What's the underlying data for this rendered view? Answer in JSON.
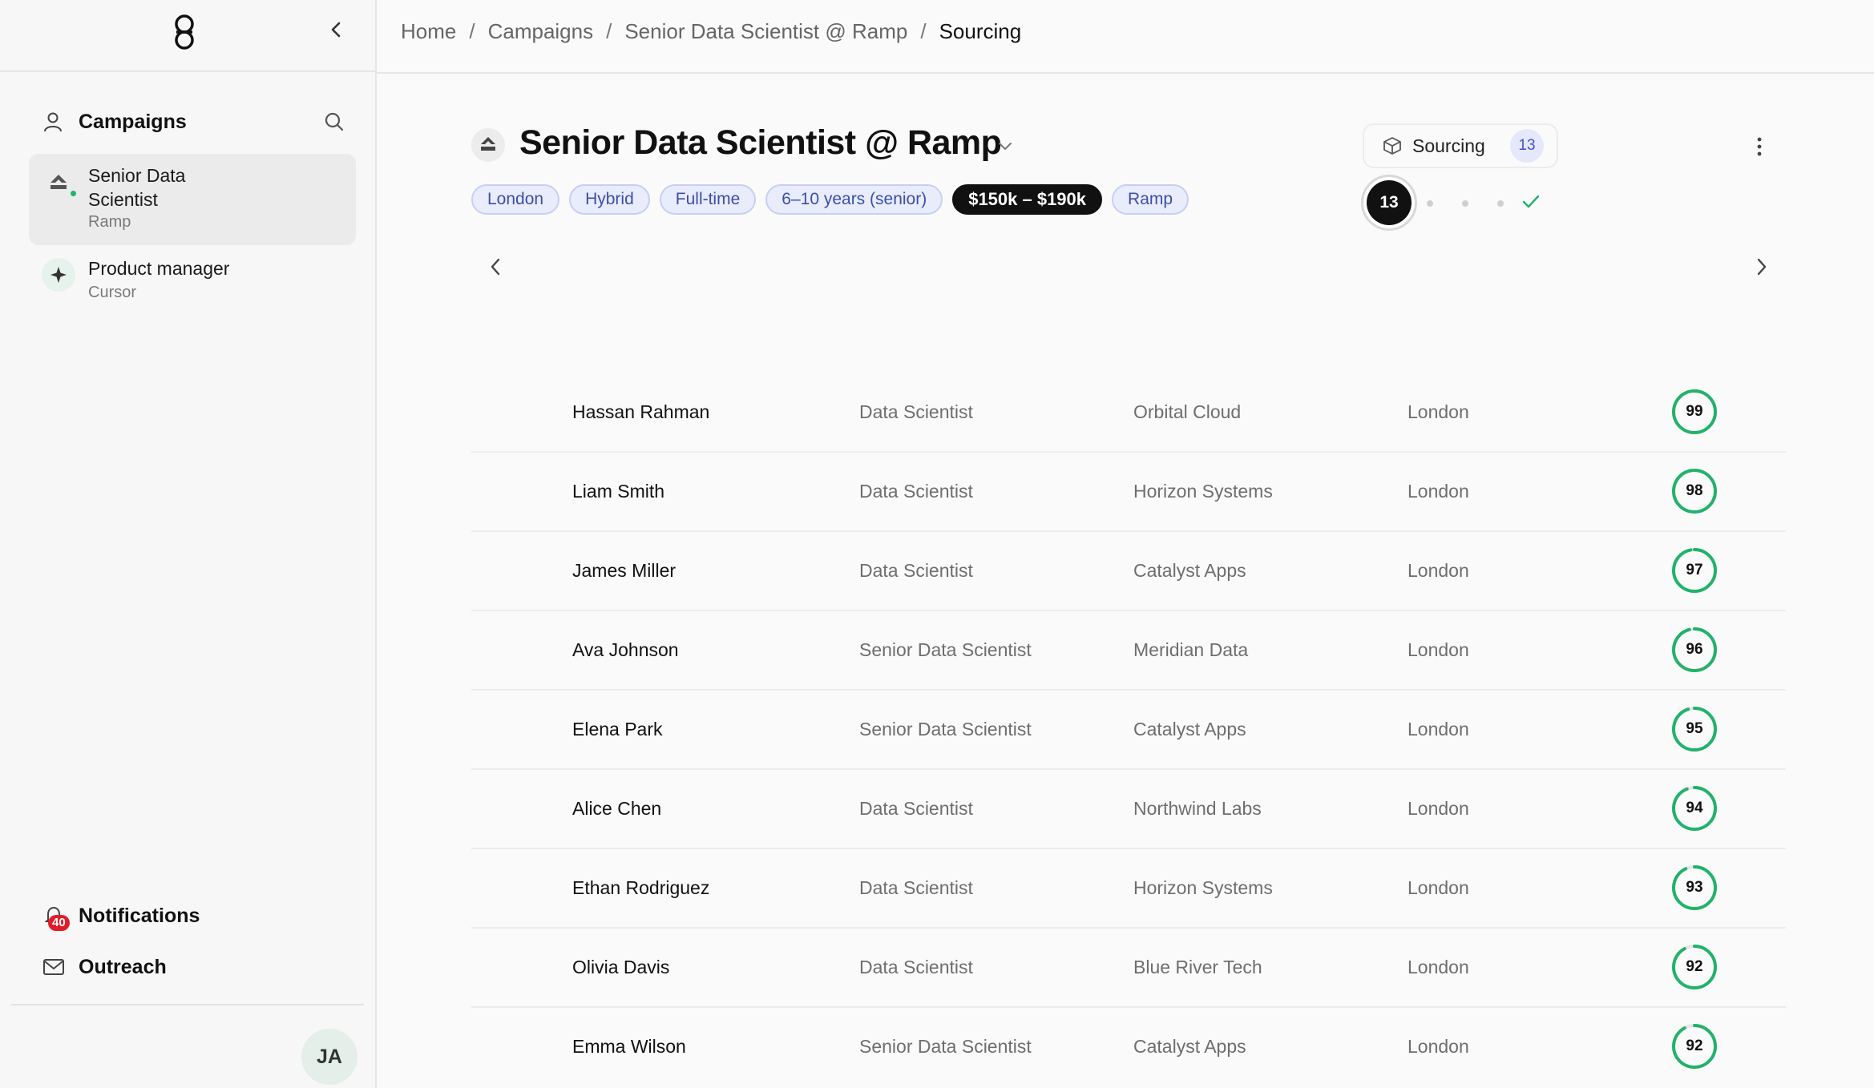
{
  "breadcrumb": [
    "Home",
    "Campaigns",
    "Senior Data Scientist @ Ramp",
    "Sourcing"
  ],
  "breadcrumb_separator": "/",
  "sidebar": {
    "section_title": "Campaigns",
    "campaigns": [
      {
        "title": "Senior Data Scientist",
        "company": "Ramp",
        "active": true
      },
      {
        "title": "Product manager",
        "company": "Cursor",
        "active": false
      }
    ],
    "notifications_label": "Notifications",
    "notifications_count": "40",
    "outreach_label": "Outreach",
    "avatar_initials": "JA"
  },
  "header": {
    "title": "Senior Data Scientist @ Ramp",
    "tags": [
      "London",
      "Hybrid",
      "Full-time",
      "6–10 years (senior)",
      "$150k – $190k",
      "Ramp"
    ],
    "highlight_tag_index": 4,
    "stage_label": "Sourcing",
    "stage_count": "13",
    "stepper_current": "13"
  },
  "colors": {
    "score_ring": "#22b26b",
    "score_track": "#e6e6e6",
    "tag_bg": "#e8ecfb",
    "tag_text": "#3d4ea6",
    "accent_dark": "#111111"
  },
  "candidates": [
    {
      "name": "Hassan Rahman",
      "role": "Data Scientist",
      "company": "Orbital Cloud",
      "location": "London",
      "score": "99"
    },
    {
      "name": "Liam Smith",
      "role": "Data Scientist",
      "company": "Horizon Systems",
      "location": "London",
      "score": "98"
    },
    {
      "name": "James Miller",
      "role": "Data Scientist",
      "company": "Catalyst Apps",
      "location": "London",
      "score": "97"
    },
    {
      "name": "Ava Johnson",
      "role": "Senior Data Scientist",
      "company": "Meridian Data",
      "location": "London",
      "score": "96"
    },
    {
      "name": "Elena Park",
      "role": "Senior Data Scientist",
      "company": "Catalyst Apps",
      "location": "London",
      "score": "95"
    },
    {
      "name": "Alice Chen",
      "role": "Data Scientist",
      "company": "Northwind Labs",
      "location": "London",
      "score": "94"
    },
    {
      "name": "Ethan Rodriguez",
      "role": "Data Scientist",
      "company": "Horizon Systems",
      "location": "London",
      "score": "93"
    },
    {
      "name": "Olivia Davis",
      "role": "Data Scientist",
      "company": "Blue River Tech",
      "location": "London",
      "score": "92"
    },
    {
      "name": "Emma Wilson",
      "role": "Senior Data Scientist",
      "company": "Catalyst Apps",
      "location": "London",
      "score": "92"
    }
  ]
}
